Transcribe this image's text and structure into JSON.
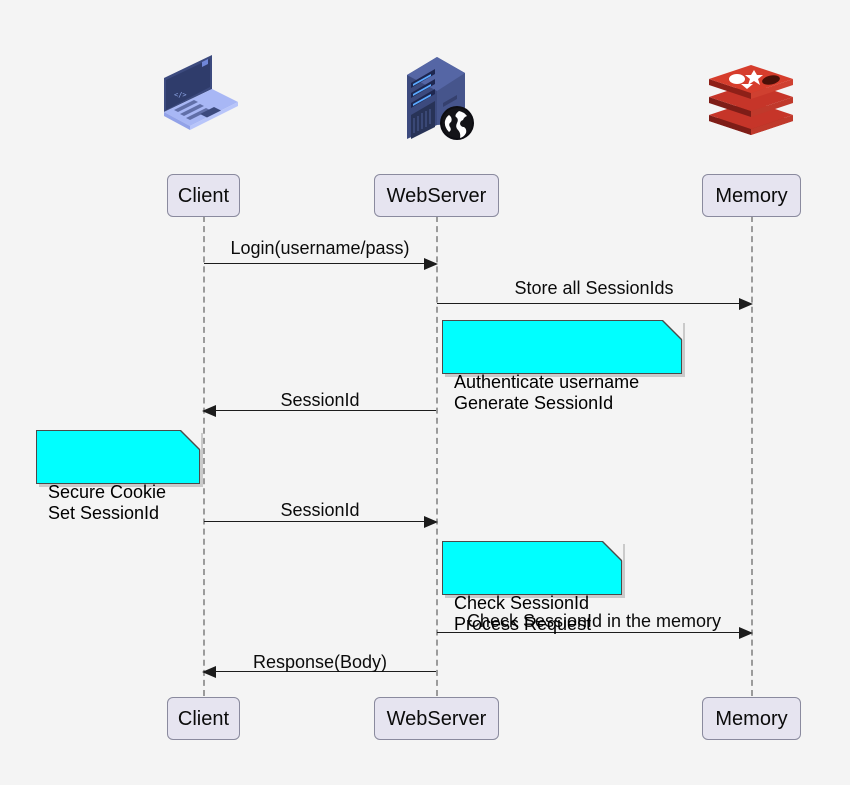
{
  "diagram": {
    "type": "sequence-diagram",
    "background_color": "#f4f4f4",
    "participant_fill": "#e6e4f0",
    "participant_border": "#8a8a9e",
    "note_fill": "#00ffff",
    "line_color": "#1c1c1c",
    "lifeline_color": "#9b9b9b"
  },
  "icons": [
    {
      "name": "laptop-icon",
      "label": "Client device laptop"
    },
    {
      "name": "web-server-icon",
      "label": "Web server tower with globe"
    },
    {
      "name": "redis-icon",
      "label": "Redis memory store stack"
    }
  ],
  "participants": [
    {
      "id": "client",
      "label": "Client"
    },
    {
      "id": "webserver",
      "label": "WebServer"
    },
    {
      "id": "memory",
      "label": "Memory"
    }
  ],
  "participants_bottom": [
    {
      "id": "client",
      "label": "Client"
    },
    {
      "id": "webserver",
      "label": "WebServer"
    },
    {
      "id": "memory",
      "label": "Memory"
    }
  ],
  "messages": [
    {
      "id": "m1",
      "label": "Login(username/pass)",
      "from": "client",
      "to": "webserver",
      "direction": "right"
    },
    {
      "id": "m2",
      "label": "Store all SessionIds",
      "from": "webserver",
      "to": "memory",
      "direction": "right"
    },
    {
      "id": "m3",
      "label": "SessionId",
      "from": "webserver",
      "to": "client",
      "direction": "left"
    },
    {
      "id": "m4",
      "label": "SessionId",
      "from": "client",
      "to": "webserver",
      "direction": "right"
    },
    {
      "id": "m5",
      "label": "Check SessionId in the memory",
      "from": "webserver",
      "to": "memory",
      "direction": "right"
    },
    {
      "id": "m6",
      "label": "Response(Body)",
      "from": "webserver",
      "to": "client",
      "direction": "left"
    }
  ],
  "notes": [
    {
      "id": "n1",
      "over": "webserver",
      "text": "Authenticate username\nGenerate SessionId"
    },
    {
      "id": "n2",
      "over": "client",
      "text": "Secure Cookie\nSet SessionId"
    },
    {
      "id": "n3",
      "over": "webserver",
      "text": "Check SessionId\nProcess Request"
    }
  ]
}
